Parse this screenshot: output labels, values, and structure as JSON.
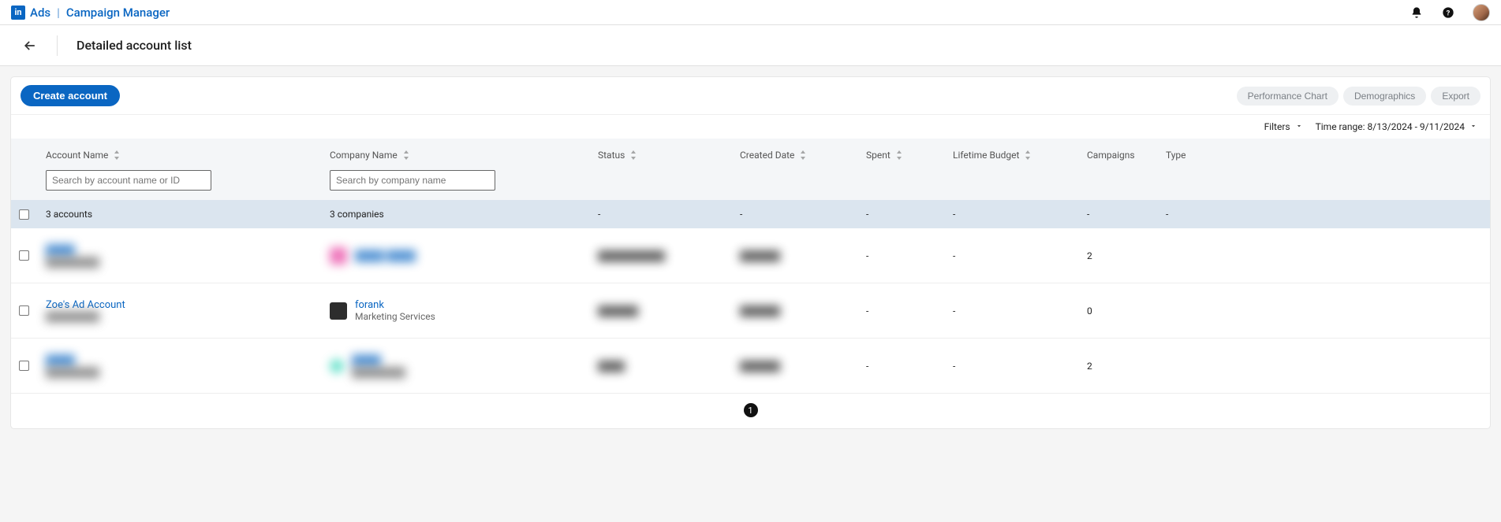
{
  "header": {
    "logo_text": "in",
    "brand_left": "Ads",
    "brand_sep": "|",
    "brand_right": "Campaign Manager"
  },
  "subheader": {
    "title": "Detailed account list"
  },
  "toolbar": {
    "create_label": "Create account",
    "pills": {
      "performance": "Performance Chart",
      "demographics": "Demographics",
      "export": "Export"
    }
  },
  "filters": {
    "filters_label": "Filters",
    "time_label": "Time range: 8/13/2024 - 9/11/2024"
  },
  "columns": {
    "account_name": "Account Name",
    "company_name": "Company Name",
    "status": "Status",
    "created": "Created Date",
    "spent": "Spent",
    "lifetime_budget": "Lifetime Budget",
    "campaigns": "Campaigns",
    "type": "Type",
    "search_account_placeholder": "Search by account name or ID",
    "search_company_placeholder": "Search by company name"
  },
  "summary": {
    "accounts": "3 accounts",
    "companies": "3 companies",
    "status": "-",
    "created": "-",
    "spent": "-",
    "lifetime": "-",
    "campaigns": "-",
    "type": "-"
  },
  "rows": [
    {
      "account_name": "████",
      "account_sub": "████████",
      "company_name": "████ ████",
      "company_sub": "",
      "logo_class": "logo-pink",
      "status": "██████████",
      "created": "██████",
      "spent": "-",
      "lifetime": "-",
      "campaigns": "2",
      "type": "",
      "blurred": true
    },
    {
      "account_name": "Zoe's Ad Account",
      "account_sub": "████████",
      "company_name": "forank",
      "company_sub": "Marketing Services",
      "logo_class": "logo-dark",
      "status": "██████",
      "created": "██████",
      "spent": "-",
      "lifetime": "-",
      "campaigns": "0",
      "type": "",
      "blurred": false
    },
    {
      "account_name": "████",
      "account_sub": "████████",
      "company_name": "████",
      "company_sub": "████████",
      "logo_class": "logo-teal",
      "status": "████",
      "created": "██████",
      "spent": "-",
      "lifetime": "-",
      "campaigns": "2",
      "type": "",
      "blurred": true
    }
  ],
  "pager": {
    "current": "1"
  }
}
